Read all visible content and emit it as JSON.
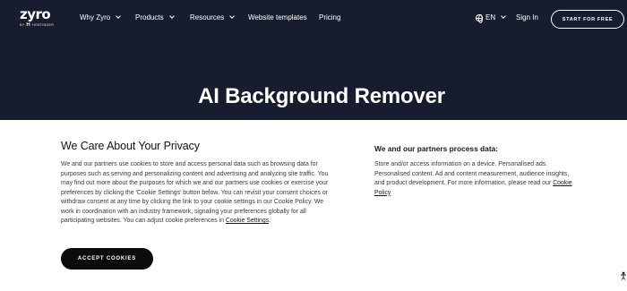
{
  "logo": {
    "word": "zyro",
    "by": "BY",
    "h": "H",
    "brand": "HOSTINGER"
  },
  "nav": {
    "items": [
      {
        "label": "Why Zyro",
        "dropdown": true
      },
      {
        "label": "Products",
        "dropdown": true
      },
      {
        "label": "Resources",
        "dropdown": true
      },
      {
        "label": "Website templates",
        "dropdown": false
      },
      {
        "label": "Pricing",
        "dropdown": false
      }
    ],
    "language": "EN",
    "sign_in": "Sign In",
    "cta": "START FOR FREE"
  },
  "hero": {
    "title": "AI Background Remover"
  },
  "consent": {
    "title": "We Care About Your Privacy",
    "text": "We and our partners use cookies to store and access personal data such as browsing data for purposes such as serving and personalizing content and advertising and analyzing site traffic. You may find out more about the purposes for which we and our partners use cookies or exercise your preferences by clicking the 'Cookie Settings' button below. You can revisit your consent choices or withdraw consent at any time by clicking the link to your cookie settings in our Cookie Policy. We work in coordination with an industry framework, signaling your preferences globally for all participating websites. You can adjust cookie preferences in",
    "settings_link": "Cookie Settings",
    "text_end": ".",
    "accept_label": "ACCEPT COOKIES",
    "partners_title": "We and our partners process data:",
    "partners_text": "Store and/or access information on a device. Personalised ads. Personalised content. Ad and content measurement, audience insights, and product development. For more information, please read our",
    "policy_link": "Cookie Policy"
  },
  "colors": {
    "header_bg": "#171d2f",
    "button_bg": "#0b0b0b",
    "text": "#3a3a3a"
  }
}
